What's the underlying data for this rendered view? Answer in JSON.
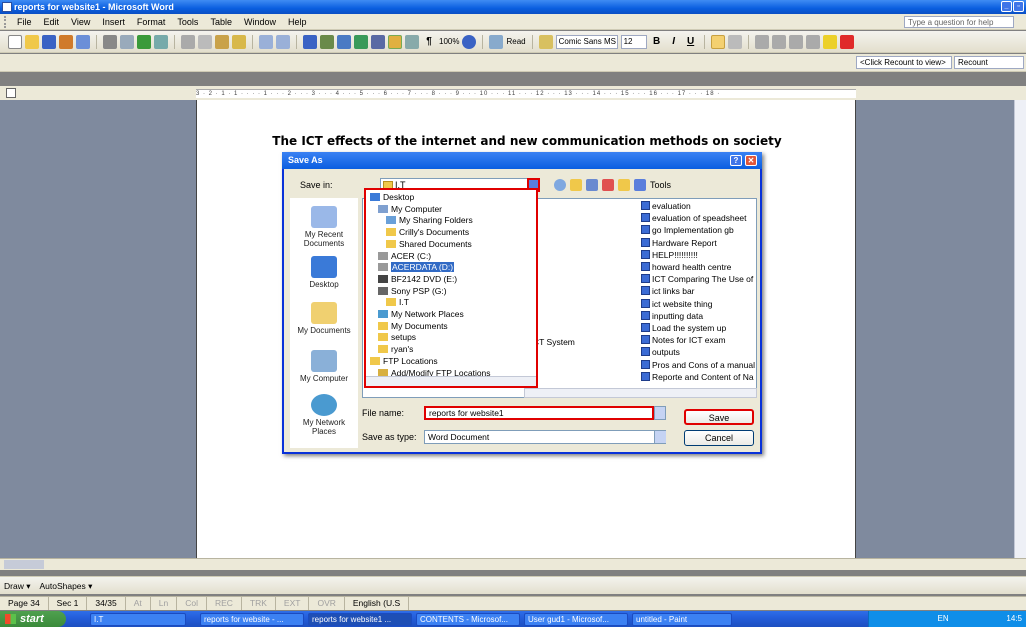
{
  "window": {
    "title": "reports for website1 - Microsoft Word"
  },
  "menu": {
    "items": [
      "File",
      "Edit",
      "View",
      "Insert",
      "Format",
      "Tools",
      "Table",
      "Window",
      "Help"
    ],
    "help_placeholder": "Type a question for help"
  },
  "toolbar": {
    "zoom": "100%",
    "read_label": "Read",
    "font": "Comic Sans MS",
    "font_size": "12",
    "bold": "B",
    "italic": "I",
    "underline": "U"
  },
  "reviewing": {
    "recount": "<Click Recount to view>",
    "recount_button": "Recount"
  },
  "ruler": {
    "ticks": "3 · 2 · 1 · 1 · · · · 1 · · · 2 · · · 3 · · · 4 · · · 5 · · · 6 · · · 7 · · · 8 · · · 9 · · · 10 · · · 11 · · · 12 · · · 13 · · · 14 · · · 15 · · · 16 · · · 17 · · · 18 ·"
  },
  "document": {
    "heading": "The ICT effects of the internet and new communication methods on society"
  },
  "dialog": {
    "title": "Save As",
    "save_in_label": "Save in:",
    "save_in_value": "I.T",
    "tools_label": "Tools",
    "places": [
      "My Recent Documents",
      "Desktop",
      "My Documents",
      "My Computer",
      "My Network Places"
    ],
    "dropdown_items": [
      {
        "label": "Desktop",
        "icon": "desktop-icon"
      },
      {
        "label": "My Computer",
        "icon": "computer-icon"
      },
      {
        "label": "My Sharing Folders",
        "icon": "shared-folder-icon"
      },
      {
        "label": "Crilly's Documents",
        "icon": "folder-icon"
      },
      {
        "label": "Shared Documents",
        "icon": "folder-icon"
      },
      {
        "label": "ACER (C:)",
        "icon": "drive-icon"
      },
      {
        "label": "ACERDATA (D:)",
        "icon": "drive-icon",
        "selected": true
      },
      {
        "label": "BF2142 DVD (E:)",
        "icon": "dvd-icon"
      },
      {
        "label": "Sony PSP (G:)",
        "icon": "removable-drive-icon"
      },
      {
        "label": "I.T",
        "icon": "folder-icon"
      },
      {
        "label": "My Network Places",
        "icon": "network-icon"
      },
      {
        "label": "My Documents",
        "icon": "folder-icon"
      },
      {
        "label": "setups",
        "icon": "folder-icon"
      },
      {
        "label": "ryan's",
        "icon": "folder-icon"
      },
      {
        "label": "FTP Locations",
        "icon": "folder-icon"
      },
      {
        "label": "Add/Modify FTP Locations",
        "icon": "ftp-icon"
      }
    ],
    "partial_file": "CT System",
    "files": [
      "evaluation",
      "evaluation of speadsheet",
      "go Implementation gb",
      "Hardware Report",
      "HELP!!!!!!!!!!",
      "howard health centre",
      "ICT Comparing The Use of",
      "ict links bar",
      "ict website thing",
      "inputting data",
      "Load the system up",
      "Notes for ICT exam",
      "outputs",
      "Pros and Cons of a manual",
      "Reporte and Content of Na"
    ],
    "file_name_label": "File name:",
    "file_name_value": "reports for website1",
    "save_as_type_label": "Save as type:",
    "save_as_type_value": "Word Document",
    "save_button": "Save",
    "cancel_button": "Cancel",
    "highlight_color": "#e00000"
  },
  "drawing": {
    "draw_label": "Draw ▾",
    "autoshapes_label": "AutoShapes ▾"
  },
  "status": {
    "page": "Page 34",
    "sec": "Sec 1",
    "pages": "34/35",
    "at": "At",
    "ln": "Ln",
    "col": "Col",
    "rec": "REC",
    "trk": "TRK",
    "ext": "EXT",
    "ovr": "OVR",
    "lang": "English (U.S"
  },
  "taskbar": {
    "start": "start",
    "tasks": [
      "I.T",
      "reports for website - ...",
      "reports for website1 ...",
      "CONTENTS - Microsof...",
      "User gud1 - Microsof...",
      "untitled - Paint"
    ],
    "clock": "14:5",
    "lang": "EN"
  }
}
